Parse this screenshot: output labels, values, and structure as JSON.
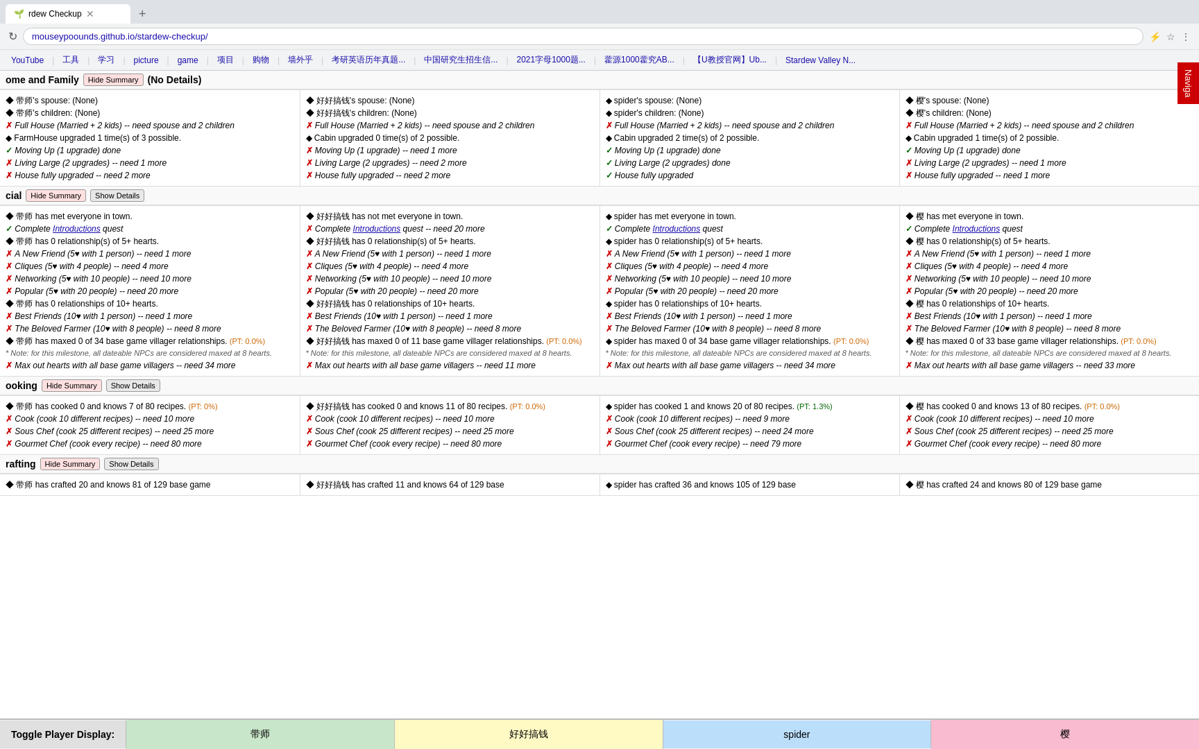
{
  "browser": {
    "tab_title": "rdew Checkup",
    "url": "mouseypoounds.github.io/stardew-checkup/",
    "bookmarks": [
      "YouTube",
      "工具",
      "学习",
      "picture",
      "game",
      "项目",
      "购物",
      "墙外乎",
      "考研英语历年真题...",
      "中国研究生招生信...",
      "2021字母1000题...",
      "藿源1000藿究AB...",
      "【U教授官网】Ub...",
      "Stardew Valley N..."
    ],
    "nav_button": "Naviga"
  },
  "sections": {
    "home_family": {
      "title": "ome and Family",
      "btn_hide": "Hide Summary",
      "btn_detail": "(No Details)",
      "players": [
        {
          "name": "带师",
          "spouse": "带师's spouse: (None)",
          "children": "带师's children: (None)",
          "full_house": {
            "status": "x",
            "text": "Full House (Married + 2 kids) -- need spouse and 2 children"
          },
          "farmhouse": "FarmHouse upgraded 1 time(s) of 3 possible.",
          "moving_up": {
            "status": "ok",
            "text": "Moving Up (1 upgrade) done"
          },
          "living_large": {
            "status": "x",
            "text": "Living Large (2 upgrades) -- need 1 more"
          },
          "house_full": {
            "status": "x",
            "text": "House fully upgraded -- need 2 more"
          }
        },
        {
          "name": "好好搞钱",
          "spouse": "好好搞钱's spouse: (None)",
          "children": "好好搞钱's children: (None)",
          "full_house": {
            "status": "x",
            "text": "Full House (Married + 2 kids) -- need spouse and 2 children"
          },
          "farmhouse": "Cabin upgraded 0 time(s) of 2 possible.",
          "moving_up": {
            "status": "x",
            "text": "Moving Up (1 upgrade) -- need 1 more"
          },
          "living_large": {
            "status": "x",
            "text": "Living Large (2 upgrades) -- need 2 more"
          },
          "house_full": {
            "status": "x",
            "text": "House fully upgraded -- need 2 more"
          }
        },
        {
          "name": "spider",
          "spouse": "spider's spouse: (None)",
          "children": "spider's children: (None)",
          "full_house": {
            "status": "x",
            "text": "Full House (Married + 2 kids) -- need spouse and 2 children"
          },
          "farmhouse": "Cabin upgraded 2 time(s) of 2 possible.",
          "moving_up": {
            "status": "ok",
            "text": "Moving Up (1 upgrade) done"
          },
          "living_large": {
            "status": "ok",
            "text": "Living Large (2 upgrades) done"
          },
          "house_full": {
            "status": "ok",
            "text": "House fully upgraded"
          }
        },
        {
          "name": "樱",
          "spouse": "樱's spouse: (None)",
          "children": "樱's children: (None)",
          "full_house": {
            "status": "x",
            "text": "Full House (Married + 2 kids) -- need spouse and 2 children"
          },
          "farmhouse": "Cabin upgraded 1 time(s) of 2 possible.",
          "moving_up": {
            "status": "ok",
            "text": "Moving Up (1 upgrade) done"
          },
          "living_large": {
            "status": "x",
            "text": "Living Large (2 upgrades) -- need 1 more"
          },
          "house_full": {
            "status": "x",
            "text": "House fully upgraded -- need 1 more"
          }
        }
      ]
    },
    "social": {
      "title": "cial",
      "btn_hide": "Hide Summary",
      "btn_show": "Show Details",
      "players": [
        {
          "name": "带师",
          "met_everyone": "带师 has met everyone in town.",
          "intros": {
            "status": "ok",
            "text": "Complete Introductions quest"
          },
          "rel_5plus": "带师 has 0 relationship(s) of 5+ hearts.",
          "new_friend": {
            "status": "x",
            "text": "A New Friend (5♥ with 1 person) -- need 1 more"
          },
          "cliques": {
            "status": "x",
            "text": "Cliques (5♥ with 4 people) -- need 4 more"
          },
          "networking": {
            "status": "x",
            "text": "Networking (5♥ with 10 people) -- need 10 more"
          },
          "popular": {
            "status": "x",
            "text": "Popular (5♥ with 20 people) -- need 20 more"
          },
          "rel_10plus": "带师 has 0 relationships of 10+ hearts.",
          "best_friends": {
            "status": "x",
            "text": "Best Friends (10♥ with 1 person) -- need 1 more"
          },
          "beloved": {
            "status": "x",
            "text": "The Beloved Farmer (10♥ with 8 people) -- need 8 more"
          },
          "maxed": "带师 has maxed 0 of 34 base game villager relationships.",
          "pt": "(PT: 0.0%)",
          "note": "* Note: for this milestone, all dateable NPCs are considered maxed at 8 hearts.",
          "max_out": {
            "status": "x",
            "text": "Max out hearts with all base game villagers -- need 34 more"
          }
        },
        {
          "name": "好好搞钱",
          "met_everyone": "好好搞钱 has not met everyone in town.",
          "intros": {
            "status": "x",
            "text": "Complete Introductions quest -- need 20 more"
          },
          "rel_5plus": "好好搞钱 has 0 relationship(s) of 5+ hearts.",
          "new_friend": {
            "status": "x",
            "text": "A New Friend (5♥ with 1 person) -- need 1 more"
          },
          "cliques": {
            "status": "x",
            "text": "Cliques (5♥ with 4 people) -- need 4 more"
          },
          "networking": {
            "status": "x",
            "text": "Networking (5♥ with 10 people) -- need 10 more"
          },
          "popular": {
            "status": "x",
            "text": "Popular (5♥ with 20 people) -- need 20 more"
          },
          "rel_10plus": "好好搞钱 has 0 relationships of 10+ hearts.",
          "best_friends": {
            "status": "x",
            "text": "Best Friends (10♥ with 1 person) -- need 1 more"
          },
          "beloved": {
            "status": "x",
            "text": "The Beloved Farmer (10♥ with 8 people) -- need 8 more"
          },
          "maxed": "好好搞钱 has maxed 0 of 11 base game villager relationships.",
          "pt": "(PT: 0.0%)",
          "note": "* Note: for this milestone, all dateable NPCs are considered maxed at 8 hearts.",
          "max_out": {
            "status": "x",
            "text": "Max out hearts with all base game villagers -- need 11 more"
          }
        },
        {
          "name": "spider",
          "met_everyone": "spider has met everyone in town.",
          "intros": {
            "status": "ok",
            "text": "Complete Introductions quest"
          },
          "rel_5plus": "spider has 0 relationship(s) of 5+ hearts.",
          "new_friend": {
            "status": "x",
            "text": "A New Friend (5♥ with 1 person) -- need 1 more"
          },
          "cliques": {
            "status": "x",
            "text": "Cliques (5♥ with 4 people) -- need 4 more"
          },
          "networking": {
            "status": "x",
            "text": "Networking (5♥ with 10 people) -- need 10 more"
          },
          "popular": {
            "status": "x",
            "text": "Popular (5♥ with 20 people) -- need 20 more"
          },
          "rel_10plus": "spider has 0 relationships of 10+ hearts.",
          "best_friends": {
            "status": "x",
            "text": "Best Friends (10♥ with 1 person) -- need 1 more"
          },
          "beloved": {
            "status": "x",
            "text": "The Beloved Farmer (10♥ with 8 people) -- need 8 more"
          },
          "maxed": "spider has maxed 0 of 34 base game villager relationships.",
          "pt": "(PT: 0.0%)",
          "note": "* Note: for this milestone, all dateable NPCs are considered maxed at 8 hearts.",
          "max_out": {
            "status": "x",
            "text": "Max out hearts with all base game villagers -- need 34 more"
          }
        },
        {
          "name": "樱",
          "met_everyone": "樱 has met everyone in town.",
          "intros": {
            "status": "ok",
            "text": "Complete Introductions quest"
          },
          "rel_5plus": "樱 has 0 relationship(s) of 5+ hearts.",
          "new_friend": {
            "status": "x",
            "text": "A New Friend (5♥ with 1 person) -- need 1 more"
          },
          "cliques": {
            "status": "x",
            "text": "Cliques (5♥ with 4 people) -- need 4 more"
          },
          "networking": {
            "status": "x",
            "text": "Networking (5♥ with 10 people) -- need 10 more"
          },
          "popular": {
            "status": "x",
            "text": "Popular (5♥ with 20 people) -- need 20 more"
          },
          "rel_10plus": "樱 has 0 relationships of 10+ hearts.",
          "best_friends": {
            "status": "x",
            "text": "Best Friends (10♥ with 1 person) -- need 1 more"
          },
          "beloved": {
            "status": "x",
            "text": "The Beloved Farmer (10♥ with 8 people) -- need 8 more"
          },
          "maxed": "樱 has maxed 0 of 33 base game villager relationships.",
          "pt": "(PT: 0.0%)",
          "note": "* Note: for this milestone, all dateable NPCs are considered maxed at 8 hearts.",
          "max_out": {
            "status": "x",
            "text": "Max out hearts with all base game villagers -- need 33 more"
          }
        }
      ]
    },
    "cooking": {
      "title": "ooking",
      "btn_hide": "Hide Summary",
      "btn_show": "Show Details",
      "players": [
        {
          "name": "带师",
          "cooked_info": "带师 has cooked 0 and knows 7 of 80 recipes.",
          "pt": "(PT: 0%)",
          "cook": {
            "status": "x",
            "text": "Cook (cook 10 different recipes) -- need 10 more"
          },
          "sous_chef": {
            "status": "x",
            "text": "Sous Chef (cook 25 different recipes) -- need 25 more"
          },
          "gourmet": {
            "status": "x",
            "text": "Gourmet Chef (cook every recipe) -- need 80 more"
          }
        },
        {
          "name": "好好搞钱",
          "cooked_info": "好好搞钱 has cooked 0 and knows 11 of 80 recipes.",
          "pt": "(PT: 0.0%)",
          "cook": {
            "status": "x",
            "text": "Cook (cook 10 different recipes) -- need 10 more"
          },
          "sous_chef": {
            "status": "x",
            "text": "Sous Chef (cook 25 different recipes) -- need 25 more"
          },
          "gourmet": {
            "status": "x",
            "text": "Gourmet Chef (cook every recipe) -- need 80 more"
          }
        },
        {
          "name": "spider",
          "cooked_info": "spider has cooked 1 and knows 20 of 80 recipes.",
          "pt": "(PT: 1.3%)",
          "cook": {
            "status": "x",
            "text": "Cook (cook 10 different recipes) -- need 9 more"
          },
          "sous_chef": {
            "status": "x",
            "text": "Sous Chef (cook 25 different recipes) -- need 24 more"
          },
          "gourmet": {
            "status": "x",
            "text": "Gourmet Chef (cook every recipe) -- need 79 more"
          }
        },
        {
          "name": "樱",
          "cooked_info": "樱 has cooked 0 and knows 13 of 80 recipes.",
          "pt": "(PT: 0.0%)",
          "cook": {
            "status": "x",
            "text": "Cook (cook 10 different recipes) -- need 10 more"
          },
          "sous_chef": {
            "status": "x",
            "text": "Sous Chef (cook 25 different recipes) -- need 25 more"
          },
          "gourmet": {
            "status": "x",
            "text": "Gourmet Chef (cook every recipe) -- need 80 more"
          }
        }
      ]
    },
    "crafting": {
      "title": "rafting",
      "btn_hide": "Hide Summary",
      "btn_show": "Show Details",
      "players": [
        {
          "name": "带师",
          "crafted_info": "带师 has crafted 20 and knows 81 of 129 base game"
        },
        {
          "name": "好好搞钱",
          "crafted_info": "好好搞钱 has crafted 11 and knows 64 of 129 base"
        },
        {
          "name": "spider",
          "crafted_info": "spider has crafted 36 and knows 105 of 129 base"
        },
        {
          "name": "樱",
          "crafted_info": "樱 has crafted 24 and knows 80 of 129 base game"
        }
      ]
    }
  },
  "toggle_bar": {
    "label": "Toggle Player Display:",
    "players": [
      "带师",
      "好好搞钱",
      "spider",
      "樱"
    ]
  },
  "show_details_labels": [
    "Show Details",
    "Show Details",
    "Show Details"
  ],
  "hide_summary_labels": [
    "Hide Summary",
    "Hide Summary",
    "Hide Summary"
  ]
}
